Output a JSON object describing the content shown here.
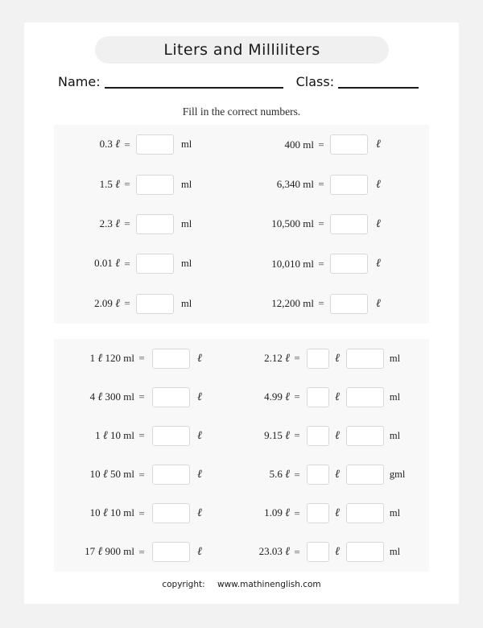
{
  "title": "Liters and Milliliters",
  "fields": {
    "name_label": "Name:",
    "class_label": "Class:"
  },
  "instruction": "Fill in the correct numbers.",
  "symbols": {
    "equals": "=",
    "liter": "ℓ"
  },
  "section1": {
    "left": [
      {
        "question": "0.3",
        "q_unit": "ℓ",
        "answer_unit": "ml"
      },
      {
        "question": "1.5",
        "q_unit": "ℓ",
        "answer_unit": "ml"
      },
      {
        "question": "2.3",
        "q_unit": "ℓ",
        "answer_unit": "ml"
      },
      {
        "question": "0.01",
        "q_unit": "ℓ",
        "answer_unit": "ml"
      },
      {
        "question": "2.09",
        "q_unit": "ℓ",
        "answer_unit": "ml"
      }
    ],
    "right": [
      {
        "question": "400 ml",
        "answer_unit": "ℓ"
      },
      {
        "question": "6,340 ml",
        "answer_unit": "ℓ"
      },
      {
        "question": "10,500 ml",
        "answer_unit": "ℓ"
      },
      {
        "question": "10,010 ml",
        "answer_unit": "ℓ"
      },
      {
        "question": "12,200 ml",
        "answer_unit": "ℓ"
      }
    ]
  },
  "section2": {
    "left": [
      {
        "liters": "1",
        "millis": "120 ml",
        "answer_unit": "ℓ"
      },
      {
        "liters": "4",
        "millis": "300 ml",
        "answer_unit": "ℓ"
      },
      {
        "liters": "1",
        "millis": "10 ml",
        "answer_unit": "ℓ"
      },
      {
        "liters": "10",
        "millis": "50 ml",
        "answer_unit": "ℓ"
      },
      {
        "liters": "10",
        "millis": "10 ml",
        "answer_unit": "ℓ"
      },
      {
        "liters": "17",
        "millis": "900 ml",
        "answer_unit": "ℓ"
      }
    ],
    "right": [
      {
        "question": "2.12",
        "q_unit": "ℓ",
        "unit_1": "ℓ",
        "unit_2": "ml"
      },
      {
        "question": "4.99",
        "q_unit": "ℓ",
        "unit_1": "ℓ",
        "unit_2": "ml"
      },
      {
        "question": "9.15",
        "q_unit": "ℓ",
        "unit_1": "ℓ",
        "unit_2": "ml"
      },
      {
        "question": "5.6",
        "q_unit": "ℓ",
        "unit_1": "ℓ",
        "unit_2": "gml"
      },
      {
        "question": "1.09",
        "q_unit": "ℓ",
        "unit_1": "ℓ",
        "unit_2": "ml"
      },
      {
        "question": "23.03",
        "q_unit": "ℓ",
        "unit_1": "ℓ",
        "unit_2": "ml"
      }
    ]
  },
  "footer": {
    "label": "copyright:",
    "url": "www.mathinenglish.com"
  }
}
